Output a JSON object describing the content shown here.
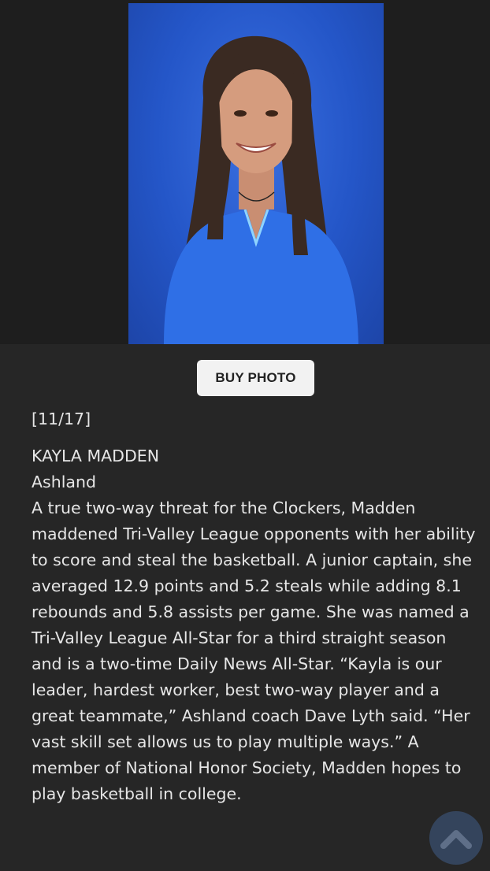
{
  "gallery": {
    "counter": "[11/17]",
    "buy_photo_label": "BUY PHOTO"
  },
  "caption": {
    "name": "KAYLA MADDEN",
    "school": "Ashland",
    "body": "A true two-way threat for the Clockers, Madden maddened Tri-Valley League opponents with her ability to score and steal the basketball. A junior captain, she averaged 12.9 points and 5.2 steals while adding 8.1 rebounds and 5.8 assists per game. She was named a Tri-Valley League All-Star for a third straight season and is a two-time Daily News All-Star. “Kayla is our leader, hardest worker, best two-way player and a great teammate,” Ashland coach Dave Lyth said. “Her vast skill set allows us to play multiple ways.” A member of National Honor Society, Madden hopes to play basketball in college."
  },
  "icons": {
    "scroll_top": "chevron-up-icon"
  },
  "colors": {
    "background": "#262626",
    "photo_backdrop": "#2456c8",
    "button_bg": "#f2f2f2",
    "scroll_button_bg": "#34445c"
  }
}
